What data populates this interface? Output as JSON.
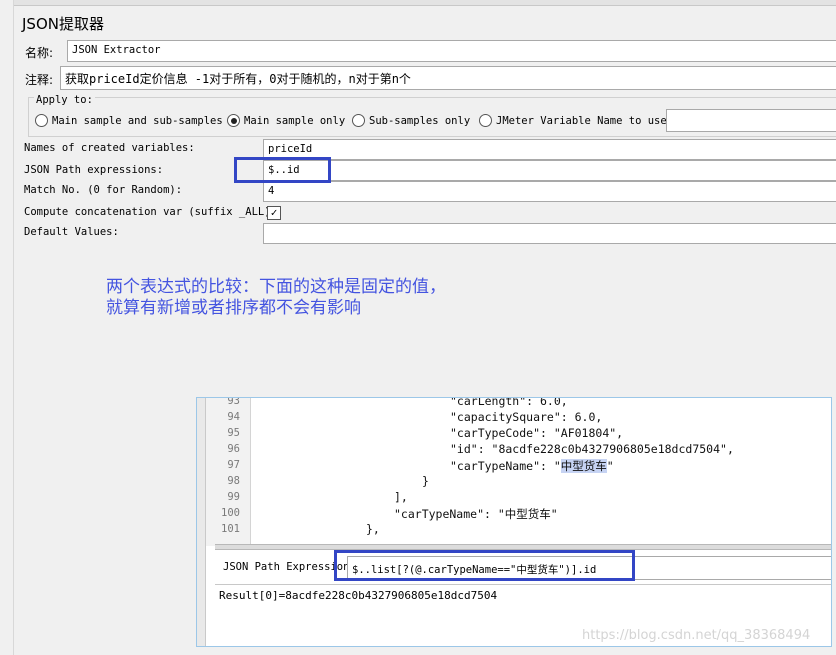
{
  "panel": {
    "title": "JSON提取器"
  },
  "form": {
    "name_label": "名称:",
    "name_value": "JSON Extractor",
    "comment_label": "注释:",
    "comment_value": "获取priceId定价信息  -1对于所有，0对于随机的，n对于第n个",
    "apply_to": {
      "legend": "Apply to:",
      "options": [
        "Main sample and sub-samples",
        "Main sample only",
        "Sub-samples only",
        "JMeter Variable Name to use"
      ],
      "selected": "Main sample only",
      "variable_value": ""
    },
    "fields": [
      {
        "label": "Names of created variables:",
        "value": "priceId"
      },
      {
        "label": "JSON Path expressions:",
        "value": "$..id"
      },
      {
        "label": "Match No. (0 for Random):",
        "value": "4"
      },
      {
        "label": "Compute concatenation var (suffix _ALL):",
        "checked": true
      },
      {
        "label": "Default Values:",
        "value": ""
      }
    ]
  },
  "annotation": {
    "line1": "两个表达式的比较：下面的这种是固定的值，",
    "line2": "就算有新增或者排序都不会有影响"
  },
  "tester": {
    "lines": [
      {
        "n": "93",
        "code": "\"carLength\": 6.0,"
      },
      {
        "n": "94",
        "code": "\"capacitySquare\": 6.0,"
      },
      {
        "n": "95",
        "code": "\"carTypeCode\": \"AF01804\","
      },
      {
        "n": "96",
        "code": "\"id\": \"8acdfe228c0b4327906805e18dcd7504\","
      },
      {
        "n": "97",
        "code_pre": "\"carTypeName\": \"",
        "code_sel": "中型货车",
        "code_post": "\""
      },
      {
        "n": "98",
        "code": "}"
      },
      {
        "n": "99",
        "code": "],"
      },
      {
        "n": "100",
        "code": "\"carTypeName\": \"中型货车\""
      },
      {
        "n": "101",
        "code": "},"
      }
    ],
    "expression_label": "JSON Path Expression",
    "expression_value": "$..list[?(@.carTypeName==\"中型货车\")].id",
    "result": "Result[0]=8acdfe228c0b4327906805e18dcd7504"
  },
  "watermark": "https://blog.csdn.net/qq_38368494",
  "colors": {
    "highlight": "#3346c5",
    "annotation": "#4454e0",
    "selection": "#c6d3f3"
  }
}
